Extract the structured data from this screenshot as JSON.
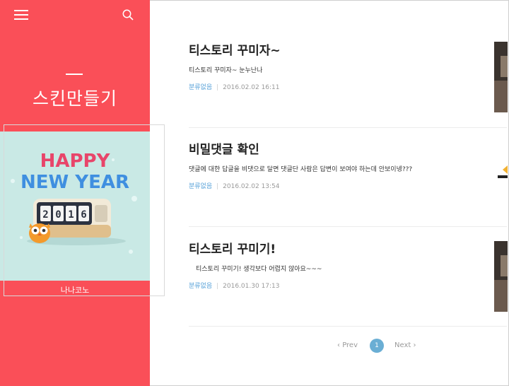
{
  "blog": {
    "title": "스킨만들기"
  },
  "profile": {
    "name": "나나코노",
    "image": {
      "line1": "HAPPY",
      "line2": "NEW YEAR",
      "year_digits": [
        "2",
        "0",
        "1",
        "6"
      ]
    }
  },
  "icons": {
    "menu": "hamburger-menu-icon",
    "search": "search-icon"
  },
  "colors": {
    "sidebar": "#fa4f58",
    "category_link": "#55a0d8",
    "page_active": "#6aaed4"
  },
  "posts": [
    {
      "title": "티스토리 꾸미자~",
      "excerpt": "티스토리 꾸미자~ 눈누난나",
      "category": "분류없음",
      "date": "2016.02.02 16:11"
    },
    {
      "title": "비밀댓글 확인",
      "excerpt": "댓글에 대한 답글을 비댓으로 달면 댓글단 사람은 답변이 보여야 하는데 안보이넹???",
      "category": "분류없음",
      "date": "2016.02.02 13:54"
    },
    {
      "title": "티스토리 꾸미기!",
      "excerpt": "티스토리 꾸미기! 생각보다 어렵지 않아요~~~",
      "category": "분류없음",
      "date": "2016.01.30 17:13"
    }
  ],
  "pagination": {
    "prev_label": "Prev",
    "current_page": "1",
    "next_label": "Next"
  }
}
